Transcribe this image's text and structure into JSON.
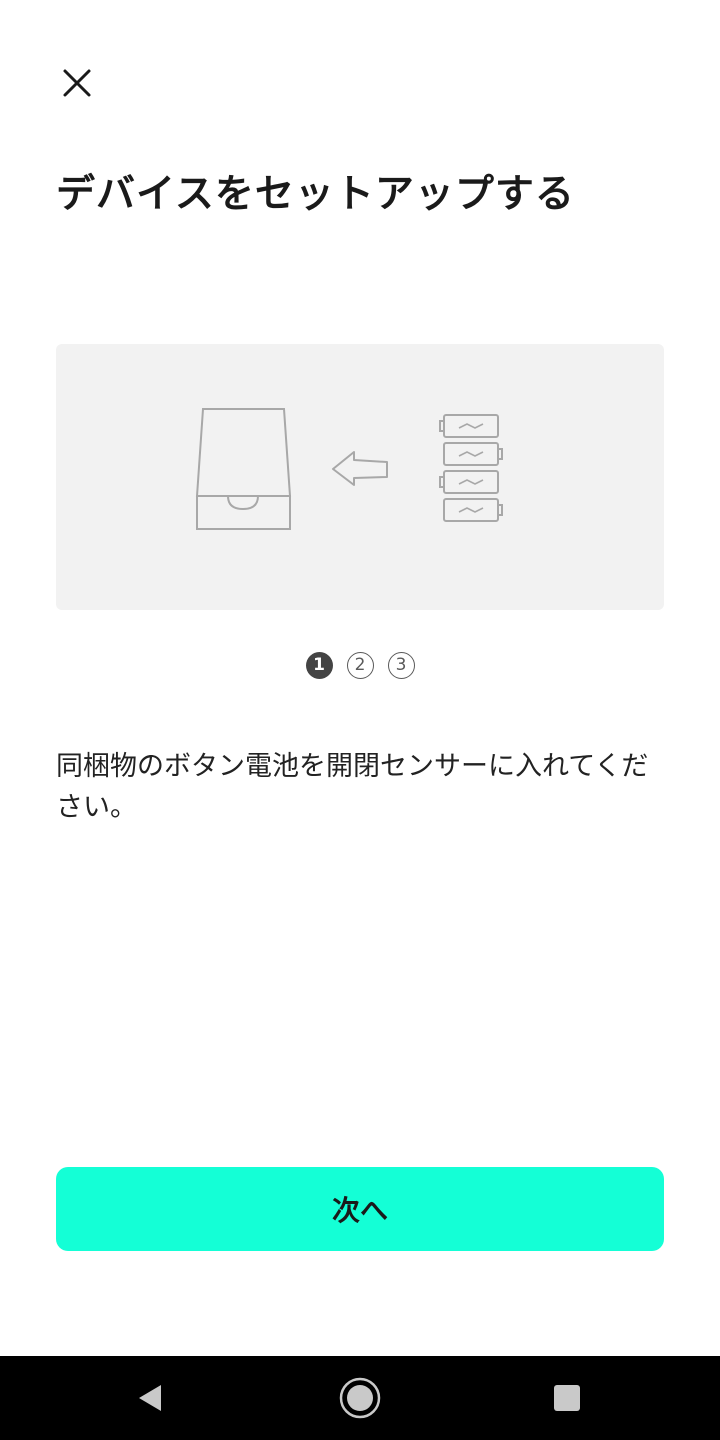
{
  "header": {
    "close_icon": "close-icon",
    "title": "デバイスをセットアップする"
  },
  "illustration": {
    "icons": [
      "sensor-device-icon",
      "arrow-left-icon",
      "battery-icon"
    ]
  },
  "steps": {
    "items": [
      "1",
      "2",
      "3"
    ],
    "current": 1
  },
  "instruction": {
    "text": "同梱物のボタン電池を開閉センサーに入れてください。"
  },
  "actions": {
    "next_label": "次へ",
    "accent_color": "#14ffd6"
  },
  "nav_bar": {
    "back_icon": "back-triangle-icon",
    "home_icon": "home-circle-icon",
    "recents_icon": "recents-square-icon"
  }
}
